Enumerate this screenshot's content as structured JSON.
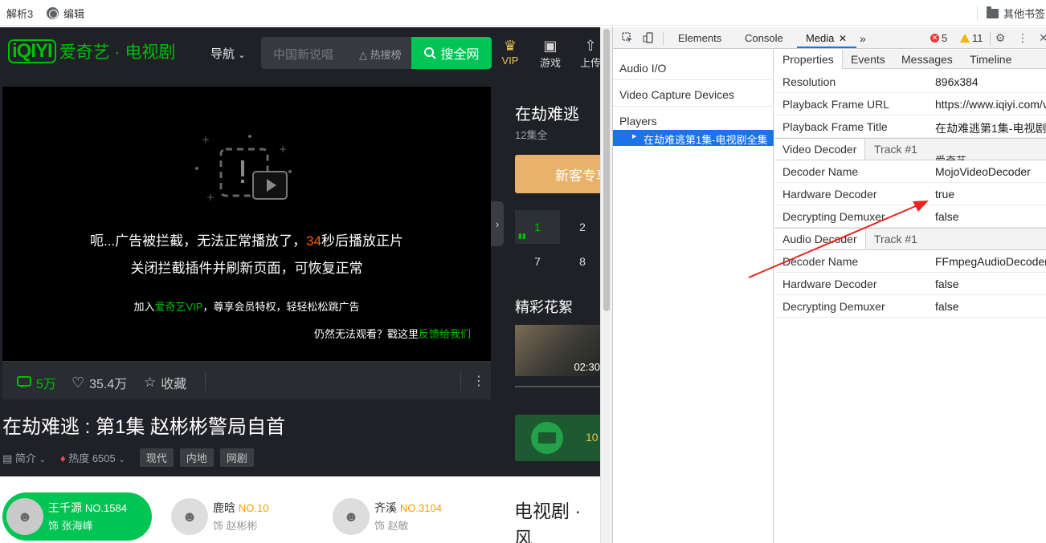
{
  "bookmarks": {
    "items": [
      "解析3",
      "编辑"
    ],
    "other": "其他书签"
  },
  "site": {
    "logo_mark": "iQIYI",
    "logo_text": "爱奇艺 · 电视剧",
    "nav": "导航",
    "search_placeholder": "中国新说唱",
    "hot_label": "热搜榜",
    "search_button": "搜全网",
    "top_icons": [
      {
        "icon": "crown-icon",
        "label": "VIP"
      },
      {
        "icon": "gamepad-icon",
        "label": "游戏"
      },
      {
        "icon": "upload-icon",
        "label": "上传"
      }
    ]
  },
  "player": {
    "msg_part1": "呃...广告被拦截，无法正常播放了，",
    "countdown": "34",
    "msg_part2": "秒后播放正片",
    "msg_line2": "关闭拦截插件并刷新页面，可恢复正常",
    "vip_prefix": "加入",
    "vip_link": "爱奇艺VIP",
    "vip_suffix": "，尊享会员特权，轻轻松松跳广告",
    "feedback_prefix": "仍然无法观看？戳这里",
    "feedback_link": "反馈给我们"
  },
  "actions": {
    "comments": "5万",
    "likes": "35.4万",
    "collect": "收藏"
  },
  "episode": {
    "title": "在劫难逃 : 第1集 赵彬彬警局自首",
    "intro": "简介",
    "heat": "热度 6505",
    "tags": [
      "现代",
      "内地",
      "网剧"
    ]
  },
  "cast": [
    {
      "name": "王千源",
      "no": "NO.1584",
      "role": "饰 张海峰"
    },
    {
      "name": "鹿晗",
      "no": "NO.10",
      "role": "饰 赵彬彬"
    },
    {
      "name": "齐溪",
      "no": "NO.3104",
      "role": "饰 赵敏"
    }
  ],
  "category_title": "电视剧 · 风",
  "sidebar": {
    "show_title": "在劫难逃",
    "episode_count": "12集全",
    "promo": "新客专享",
    "episodes": [
      "1",
      "2",
      "7",
      "8"
    ],
    "highlights_title": "精彩花絮",
    "clip_duration": "02:30",
    "card_text": "10"
  },
  "devtools": {
    "tabs": [
      "Elements",
      "Console",
      "Media"
    ],
    "errors": "5",
    "warnings": "11",
    "left_items": [
      "Audio I/O",
      "Video Capture Devices",
      "Players"
    ],
    "player_item": "在劫难逃第1集-电视剧全集",
    "subtabs": [
      "Properties",
      "Events",
      "Messages",
      "Timeline"
    ],
    "properties": [
      {
        "k": "Resolution",
        "v": "896x384"
      },
      {
        "k": "Playback Frame URL",
        "v": "https://www.iqiyi.com/v"
      },
      {
        "k": "Playback Frame Title",
        "v": "在劫难逃第1集-电视剧"
      }
    ],
    "title_overflow": "爱奇艺",
    "video_decoder": {
      "section": "Video Decoder",
      "track": "Track #1",
      "rows": [
        {
          "k": "Decoder Name",
          "v": "MojoVideoDecoder"
        },
        {
          "k": "Hardware Decoder",
          "v": "true"
        },
        {
          "k": "Decrypting Demuxer",
          "v": "false"
        }
      ]
    },
    "audio_decoder": {
      "section": "Audio Decoder",
      "track": "Track #1",
      "rows": [
        {
          "k": "Decoder Name",
          "v": "FFmpegAudioDecoder"
        },
        {
          "k": "Hardware Decoder",
          "v": "false"
        },
        {
          "k": "Decrypting Demuxer",
          "v": "false"
        }
      ]
    }
  },
  "colors": {
    "iqiyi_green": "#00be06",
    "search_green": "#00c453",
    "countdown_orange": "#ff5f00",
    "devtools_blue": "#1a73e8",
    "annotation_red": "#e8251f"
  }
}
